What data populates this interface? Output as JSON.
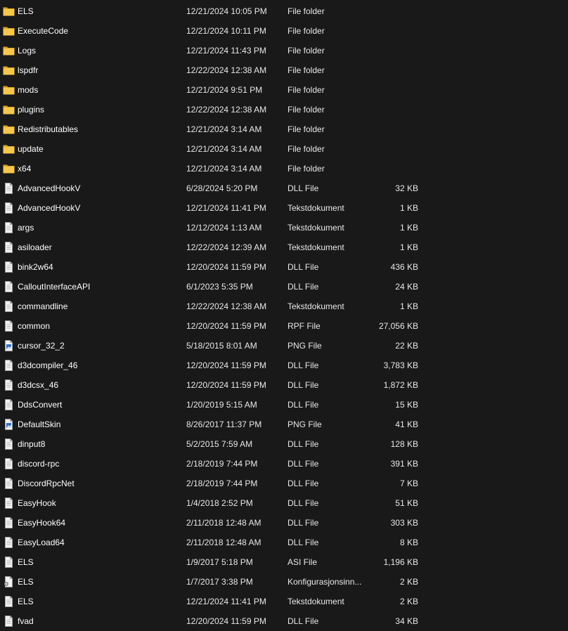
{
  "files": [
    {
      "name": "ELS",
      "date": "12/21/2024 10:05 PM",
      "type": "File folder",
      "size": "",
      "icon": "folder-icon"
    },
    {
      "name": "ExecuteCode",
      "date": "12/21/2024 10:11 PM",
      "type": "File folder",
      "size": "",
      "icon": "folder-icon"
    },
    {
      "name": "Logs",
      "date": "12/21/2024 11:43 PM",
      "type": "File folder",
      "size": "",
      "icon": "folder-icon"
    },
    {
      "name": "lspdfr",
      "date": "12/22/2024 12:38 AM",
      "type": "File folder",
      "size": "",
      "icon": "folder-icon"
    },
    {
      "name": "mods",
      "date": "12/21/2024 9:51 PM",
      "type": "File folder",
      "size": "",
      "icon": "folder-icon"
    },
    {
      "name": "plugins",
      "date": "12/22/2024 12:38 AM",
      "type": "File folder",
      "size": "",
      "icon": "folder-icon"
    },
    {
      "name": "Redistributables",
      "date": "12/21/2024 3:14 AM",
      "type": "File folder",
      "size": "",
      "icon": "folder-icon"
    },
    {
      "name": "update",
      "date": "12/21/2024 3:14 AM",
      "type": "File folder",
      "size": "",
      "icon": "folder-icon"
    },
    {
      "name": "x64",
      "date": "12/21/2024 3:14 AM",
      "type": "File folder",
      "size": "",
      "icon": "folder-icon"
    },
    {
      "name": "AdvancedHookV",
      "date": "6/28/2024 5:20 PM",
      "type": "DLL File",
      "size": "32 KB",
      "icon": "file-icon"
    },
    {
      "name": "AdvancedHookV",
      "date": "12/21/2024 11:41 PM",
      "type": "Tekstdokument",
      "size": "1 KB",
      "icon": "file-icon"
    },
    {
      "name": "args",
      "date": "12/12/2024 1:13 AM",
      "type": "Tekstdokument",
      "size": "1 KB",
      "icon": "file-icon"
    },
    {
      "name": "asiloader",
      "date": "12/22/2024 12:39 AM",
      "type": "Tekstdokument",
      "size": "1 KB",
      "icon": "file-icon"
    },
    {
      "name": "bink2w64",
      "date": "12/20/2024 11:59 PM",
      "type": "DLL File",
      "size": "436 KB",
      "icon": "file-icon"
    },
    {
      "name": "CalloutInterfaceAPI",
      "date": "6/1/2023 5:35 PM",
      "type": "DLL File",
      "size": "24 KB",
      "icon": "file-icon"
    },
    {
      "name": "commandline",
      "date": "12/22/2024 12:38 AM",
      "type": "Tekstdokument",
      "size": "1 KB",
      "icon": "file-icon"
    },
    {
      "name": "common",
      "date": "12/20/2024 11:59 PM",
      "type": "RPF File",
      "size": "27,056 KB",
      "icon": "file-icon"
    },
    {
      "name": "cursor_32_2",
      "date": "5/18/2015 8:01 AM",
      "type": "PNG File",
      "size": "22 KB",
      "icon": "image-file-icon"
    },
    {
      "name": "d3dcompiler_46",
      "date": "12/20/2024 11:59 PM",
      "type": "DLL File",
      "size": "3,783 KB",
      "icon": "file-icon"
    },
    {
      "name": "d3dcsx_46",
      "date": "12/20/2024 11:59 PM",
      "type": "DLL File",
      "size": "1,872 KB",
      "icon": "file-icon"
    },
    {
      "name": "DdsConvert",
      "date": "1/20/2019 5:15 AM",
      "type": "DLL File",
      "size": "15 KB",
      "icon": "file-icon"
    },
    {
      "name": "DefaultSkin",
      "date": "8/26/2017 11:37 PM",
      "type": "PNG File",
      "size": "41 KB",
      "icon": "image-file-icon"
    },
    {
      "name": "dinput8",
      "date": "5/2/2015 7:59 AM",
      "type": "DLL File",
      "size": "128 KB",
      "icon": "file-icon"
    },
    {
      "name": "discord-rpc",
      "date": "2/18/2019 7:44 PM",
      "type": "DLL File",
      "size": "391 KB",
      "icon": "file-icon"
    },
    {
      "name": "DiscordRpcNet",
      "date": "2/18/2019 7:44 PM",
      "type": "DLL File",
      "size": "7 KB",
      "icon": "file-icon"
    },
    {
      "name": "EasyHook",
      "date": "1/4/2018 2:52 PM",
      "type": "DLL File",
      "size": "51 KB",
      "icon": "file-icon"
    },
    {
      "name": "EasyHook64",
      "date": "2/11/2018 12:48 AM",
      "type": "DLL File",
      "size": "303 KB",
      "icon": "file-icon"
    },
    {
      "name": "EasyLoad64",
      "date": "2/11/2018 12:48 AM",
      "type": "DLL File",
      "size": "8 KB",
      "icon": "file-icon"
    },
    {
      "name": "ELS",
      "date": "1/9/2017 5:18 PM",
      "type": "ASI File",
      "size": "1,196 KB",
      "icon": "file-icon"
    },
    {
      "name": "ELS",
      "date": "1/7/2017 3:38 PM",
      "type": "Konfigurasjonsinn...",
      "size": "2 KB",
      "icon": "config-file-icon"
    },
    {
      "name": "ELS",
      "date": "12/21/2024 11:41 PM",
      "type": "Tekstdokument",
      "size": "2 KB",
      "icon": "file-icon"
    },
    {
      "name": "fvad",
      "date": "12/20/2024 11:59 PM",
      "type": "DLL File",
      "size": "34 KB",
      "icon": "file-icon"
    }
  ]
}
